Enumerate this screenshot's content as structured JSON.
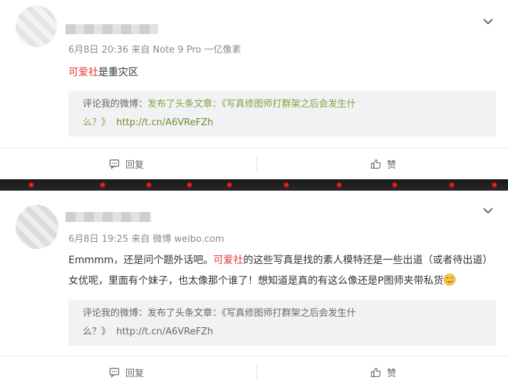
{
  "posts": [
    {
      "meta": "6月8日 20:36 来自 Note 9 Pro 一亿像素",
      "content": [
        {
          "text": "可爱社",
          "highlight": true
        },
        {
          "text": "是重灾区",
          "highlight": false
        }
      ],
      "quote": {
        "prefix": "评论我的微博：",
        "action": "发布了头条文章：",
        "title": "《写真修图师打群架之后会发生什",
        "title_end": "么？》",
        "link": "http://t.cn/A6VReFZh"
      },
      "reply_label": "回复",
      "like_label": "赞"
    },
    {
      "meta": "6月8日 19:25 来自 微博 weibo.com",
      "content": [
        {
          "text": "Emmmm，还是问个题外话吧。",
          "highlight": false
        },
        {
          "text": "可爱社",
          "highlight": true
        },
        {
          "text": "的这些写真是找的素人模特还是一些出道（或者待出道）女优呢，里面有个妹子，也太像那个谁了！想知道是真的有这么像还是P图师夹带私货",
          "highlight": false
        }
      ],
      "quote": {
        "prefix": "评论我的微博：",
        "action": "发布了头条文章：",
        "title": "《写真修图师打群架之后会发生什",
        "title_end": "么？》",
        "link": "http://t.cn/A6VReFZh"
      },
      "reply_label": "回复",
      "like_label": "赞"
    }
  ],
  "icons": {
    "expand": "chevron-down-icon",
    "reply": "comment-icon",
    "like": "thumbs-up-icon",
    "emoji": "smirk-emoji-icon"
  },
  "colors": {
    "highlight": "#e0352a",
    "quote_action": "#7da53e",
    "link": "#6b8e23",
    "meta": "#8a8a8a",
    "quote_bg": "#f2f2f5"
  }
}
